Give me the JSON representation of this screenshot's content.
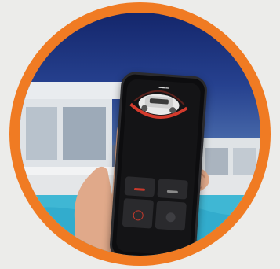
{
  "scene": {
    "ring_color": "#f07b23",
    "accent_color": "#c8392b"
  },
  "phone_app": {
    "title_icon": "robot-pool-cleaner-icon",
    "tiles": [
      "status-tile",
      "mode-tile",
      "power-button",
      "start-button"
    ]
  }
}
